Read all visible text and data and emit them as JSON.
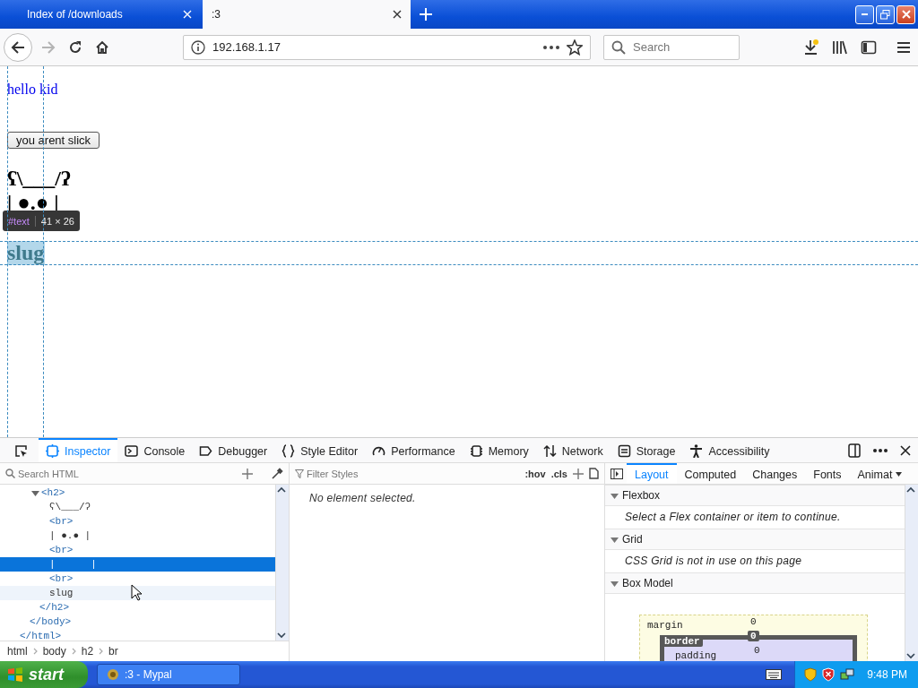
{
  "tabs": [
    {
      "label": "Index of /downloads",
      "selected": false
    },
    {
      "label": ":3",
      "selected": true
    }
  ],
  "toolbar": {
    "forward": {
      "disabled": true
    },
    "address": "192.168.1.17",
    "search": {
      "placeholder": "Search"
    },
    "downloads": {
      "attention": true
    }
  },
  "page": {
    "link": "hello kid",
    "button": "you arent slick",
    "heading": [
      {
        "text": "ʕ\\___/ʔ",
        "highlighted": false
      },
      {
        "text": "| ●.● |",
        "highlighted": false
      },
      {
        "text": "slug",
        "highlighted": true
      }
    ],
    "tooltip": {
      "node": "#text",
      "size": "41 × 26"
    }
  },
  "devtools": {
    "tools": [
      {
        "kind": "inspector",
        "label": "Inspector",
        "selected": true
      },
      {
        "kind": "console",
        "label": "Console",
        "selected": false
      },
      {
        "kind": "debugger",
        "label": "Debugger",
        "selected": false
      },
      {
        "kind": "style",
        "label": "Style Editor",
        "selected": false
      },
      {
        "kind": "performance",
        "label": "Performance",
        "selected": false
      },
      {
        "kind": "memory",
        "label": "Memory",
        "selected": false
      },
      {
        "kind": "network",
        "label": "Network",
        "selected": false
      },
      {
        "kind": "storage",
        "label": "Storage",
        "selected": false
      },
      {
        "kind": "accessibility",
        "label": "Accessibility",
        "selected": false
      }
    ],
    "markup_search": {
      "placeholder": "Search HTML"
    },
    "rules_filter": {
      "placeholder": "Filter Styles"
    },
    "pseudo_toggles": [
      ":hov",
      ".cls"
    ],
    "markup": [
      {
        "close": "</html>",
        "selected": false,
        "hovered": false,
        "children": [
          {
            "close": "</body>",
            "selected": false,
            "hovered": false,
            "children": [
              {
                "open": "<h2>",
                "close": "</h2>",
                "expanded": true,
                "selected": false,
                "hovered": false,
                "children": [
                  {
                    "text": "ʕ\\___/ʔ",
                    "selected": false,
                    "hovered": false
                  },
                  {
                    "open": "<br>",
                    "selected": false,
                    "hovered": false
                  },
                  {
                    "text": "| ●.● |",
                    "selected": false,
                    "hovered": false
                  },
                  {
                    "open": "<br>",
                    "selected": false,
                    "hovered": false
                  },
                  {
                    "text": "|      |",
                    "selected": true,
                    "hovered": false
                  },
                  {
                    "open": "<br>",
                    "selected": false,
                    "hovered": false
                  },
                  {
                    "text": "slug",
                    "selected": false,
                    "hovered": true
                  }
                ]
              }
            ]
          }
        ]
      }
    ],
    "rules_message": "No element selected.",
    "sidebar_tabs": [
      {
        "label": "Layout",
        "selected": true
      },
      {
        "label": "Computed",
        "selected": false
      },
      {
        "label": "Changes",
        "selected": false
      },
      {
        "label": "Fonts",
        "selected": false
      },
      {
        "label": "Animat",
        "selected": false
      }
    ],
    "layout_sections": [
      {
        "kind": "message",
        "title": "Flexbox",
        "expanded": true,
        "message": "Select a Flex container or item to continue."
      },
      {
        "kind": "message",
        "title": "Grid",
        "expanded": true,
        "message": "CSS Grid is not in use on this page"
      },
      {
        "kind": "box_model",
        "title": "Box Model",
        "expanded": true
      }
    ],
    "box_model": {
      "layers": [
        {
          "label": "margin",
          "value": "0"
        },
        {
          "label": "border",
          "value": "0"
        },
        {
          "label": "padding",
          "value": "0"
        }
      ]
    },
    "breadcrumbs": [
      "html",
      "body",
      "h2",
      "br"
    ]
  },
  "taskbar": {
    "start": "start",
    "tasks": [
      ":3 - Mypal"
    ],
    "clock": "9:48 PM"
  }
}
